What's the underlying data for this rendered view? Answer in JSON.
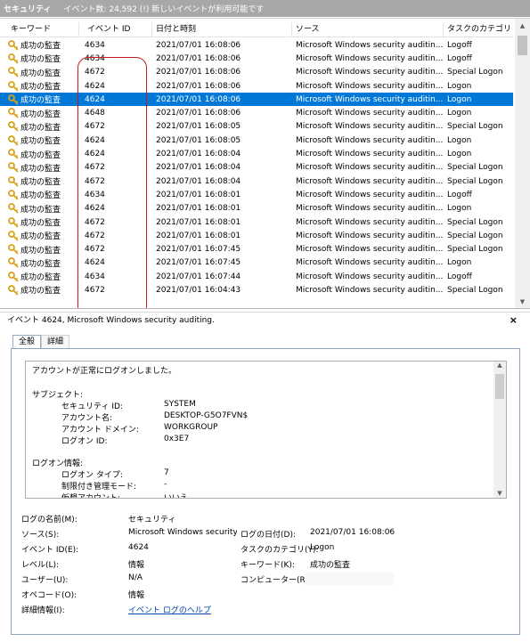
{
  "title": {
    "log_name": "セキュリティ",
    "event_count_text": "イベント数: 24,592 (!) 新しいイベントが利用可能です"
  },
  "columns": [
    "キーワード",
    "イベント ID",
    "日付と時刻",
    "ソース",
    "タスクのカテゴリ"
  ],
  "events": [
    {
      "keyword": "成功の監査",
      "id": "4634",
      "datetime": "2021/07/01 16:08:06",
      "source": "Microsoft Windows security auditin...",
      "category": "Logoff"
    },
    {
      "keyword": "成功の監査",
      "id": "4634",
      "datetime": "2021/07/01 16:08:06",
      "source": "Microsoft Windows security auditin...",
      "category": "Logoff"
    },
    {
      "keyword": "成功の監査",
      "id": "4672",
      "datetime": "2021/07/01 16:08:06",
      "source": "Microsoft Windows security auditin...",
      "category": "Special Logon"
    },
    {
      "keyword": "成功の監査",
      "id": "4624",
      "datetime": "2021/07/01 16:08:06",
      "source": "Microsoft Windows security auditin...",
      "category": "Logon"
    },
    {
      "keyword": "成功の監査",
      "id": "4624",
      "datetime": "2021/07/01 16:08:06",
      "source": "Microsoft Windows security auditin...",
      "category": "Logon"
    },
    {
      "keyword": "成功の監査",
      "id": "4648",
      "datetime": "2021/07/01 16:08:06",
      "source": "Microsoft Windows security auditin...",
      "category": "Logon"
    },
    {
      "keyword": "成功の監査",
      "id": "4672",
      "datetime": "2021/07/01 16:08:05",
      "source": "Microsoft Windows security auditin...",
      "category": "Special Logon"
    },
    {
      "keyword": "成功の監査",
      "id": "4624",
      "datetime": "2021/07/01 16:08:05",
      "source": "Microsoft Windows security auditin...",
      "category": "Logon"
    },
    {
      "keyword": "成功の監査",
      "id": "4624",
      "datetime": "2021/07/01 16:08:04",
      "source": "Microsoft Windows security auditin...",
      "category": "Logon"
    },
    {
      "keyword": "成功の監査",
      "id": "4672",
      "datetime": "2021/07/01 16:08:04",
      "source": "Microsoft Windows security auditin...",
      "category": "Special Logon"
    },
    {
      "keyword": "成功の監査",
      "id": "4672",
      "datetime": "2021/07/01 16:08:04",
      "source": "Microsoft Windows security auditin...",
      "category": "Special Logon"
    },
    {
      "keyword": "成功の監査",
      "id": "4634",
      "datetime": "2021/07/01 16:08:01",
      "source": "Microsoft Windows security auditin...",
      "category": "Logoff"
    },
    {
      "keyword": "成功の監査",
      "id": "4624",
      "datetime": "2021/07/01 16:08:01",
      "source": "Microsoft Windows security auditin...",
      "category": "Logon"
    },
    {
      "keyword": "成功の監査",
      "id": "4672",
      "datetime": "2021/07/01 16:08:01",
      "source": "Microsoft Windows security auditin...",
      "category": "Special Logon"
    },
    {
      "keyword": "成功の監査",
      "id": "4672",
      "datetime": "2021/07/01 16:08:01",
      "source": "Microsoft Windows security auditin...",
      "category": "Special Logon"
    },
    {
      "keyword": "成功の監査",
      "id": "4672",
      "datetime": "2021/07/01 16:07:45",
      "source": "Microsoft Windows security auditin...",
      "category": "Special Logon"
    },
    {
      "keyword": "成功の監査",
      "id": "4624",
      "datetime": "2021/07/01 16:07:45",
      "source": "Microsoft Windows security auditin...",
      "category": "Logon"
    },
    {
      "keyword": "成功の監査",
      "id": "4634",
      "datetime": "2021/07/01 16:07:44",
      "source": "Microsoft Windows security auditin...",
      "category": "Logoff"
    },
    {
      "keyword": "成功の監査",
      "id": "4672",
      "datetime": "2021/07/01 16:04:43",
      "source": "Microsoft Windows security auditin...",
      "category": "Special Logon"
    }
  ],
  "selected_row_number": 5,
  "detail": {
    "header": "イベント 4624, Microsoft Windows security auditing.",
    "close_glyph": "×",
    "tabs": [
      "全般",
      "詳細"
    ],
    "message": {
      "intro": "アカウントが正常にログオンしました。",
      "subject_heading": "サブジェクト:",
      "subject_fields": [
        {
          "label": "セキュリティ ID:",
          "value": "SYSTEM"
        },
        {
          "label": "アカウント名:",
          "value": "DESKTOP-G5O7FVN$"
        },
        {
          "label": "アカウント ドメイン:",
          "value": "WORKGROUP"
        },
        {
          "label": "ログオン ID:",
          "value": "0x3E7"
        }
      ],
      "logon_heading": "ログオン情報:",
      "logon_fields": [
        {
          "label": "ログオン タイプ:",
          "value": "7"
        },
        {
          "label": "制限付き管理モード:",
          "value": "-"
        },
        {
          "label": "仮想アカウント:",
          "value": "いいえ"
        }
      ]
    },
    "props": {
      "log_name_label": "ログの名前(M):",
      "log_name_value": "セキュリティ",
      "source_label": "ソース(S):",
      "source_value": "Microsoft Windows security a",
      "logged_label": "ログの日付(D):",
      "logged_value": "2021/07/01 16:08:06",
      "event_id_label": "イベント ID(E):",
      "event_id_value": "4624",
      "task_label": "タスクのカテゴリ(Y):",
      "task_value": "Logon",
      "level_label": "レベル(L):",
      "level_value": "情報",
      "keywords_label": "キーワード(K):",
      "keywords_value": "成功の監査",
      "user_label": "ユーザー(U):",
      "user_value": "N/A",
      "computer_label": "コンピューター(R):",
      "opcode_label": "オペコード(O):",
      "opcode_value": "情報",
      "more_info_label": "詳細情報(I):",
      "more_info_link": "イベント ログのヘルプ"
    }
  },
  "colors": {
    "selection": "#0078d7",
    "annotation_box": "#c41a20",
    "key_icon": "#d9a21b"
  }
}
